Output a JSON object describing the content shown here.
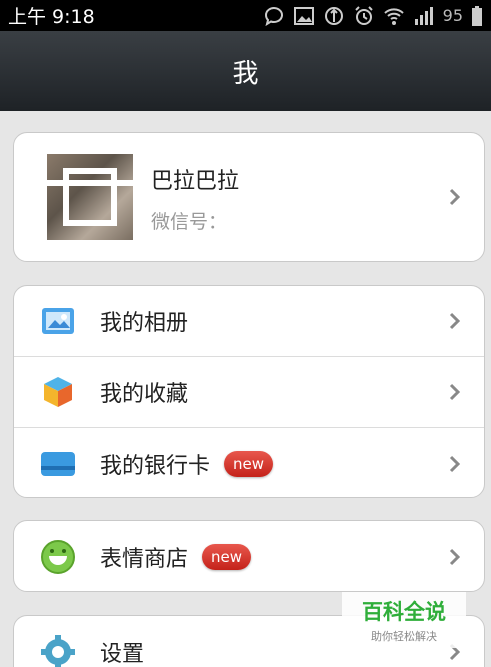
{
  "status_bar": {
    "time": "上午 9:18",
    "battery": "95",
    "icons": [
      "chat-bubble-icon",
      "image-icon",
      "sync-icon",
      "alarm-icon",
      "wifi-icon",
      "signal-icon",
      "battery-icon"
    ]
  },
  "title_bar": {
    "title": "我"
  },
  "profile": {
    "name": "巴拉巴拉",
    "wechat_label": "微信号："
  },
  "menu_group1": [
    {
      "label": "我的相册",
      "icon": "photo-album-icon",
      "badge": ""
    },
    {
      "label": "我的收藏",
      "icon": "favorites-cube-icon",
      "badge": ""
    },
    {
      "label": "我的银行卡",
      "icon": "bank-card-icon",
      "badge": "new"
    }
  ],
  "menu_group2": [
    {
      "label": "表情商店",
      "icon": "smiley-icon",
      "badge": "new"
    }
  ],
  "menu_group3": [
    {
      "label": "设置",
      "icon": "settings-gear-icon",
      "badge": ""
    }
  ],
  "watermark": {
    "title": "百科全说",
    "subtitle": "助你轻松解决"
  },
  "colors": {
    "title_bar": "#262a2e",
    "badge": "#d8362c",
    "background": "#e6e6e6",
    "watermark_green": "#2fae3a"
  }
}
